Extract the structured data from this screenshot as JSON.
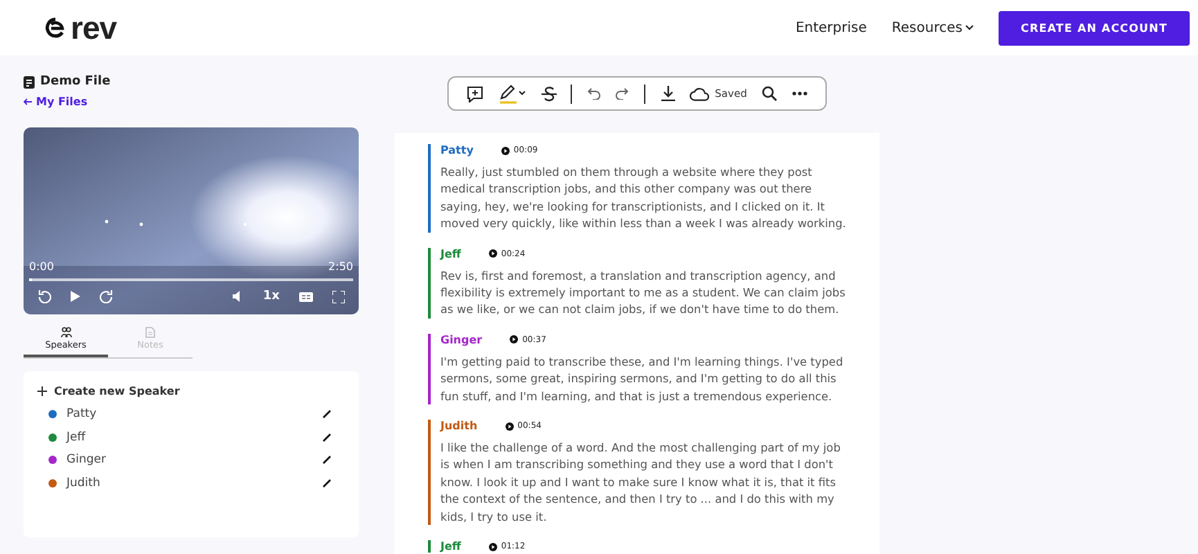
{
  "header": {
    "logo": "rev",
    "nav": [
      {
        "label": "Enterprise",
        "kind": "link"
      },
      {
        "label": "Resources",
        "kind": "dropdown"
      }
    ],
    "cta": "CREATE AN ACCOUNT"
  },
  "file": {
    "title": "Demo File",
    "back": "My Files"
  },
  "player": {
    "current": "0:00",
    "duration": "2:50",
    "level": 0,
    "speed": "1x"
  },
  "side_tabs": [
    {
      "label": "Speakers",
      "selected": true
    },
    {
      "label": "Notes",
      "selected": false
    }
  ],
  "speakers": {
    "create": "Create new Speaker",
    "items": [
      {
        "name": "Patty",
        "color": "#1f6cc1"
      },
      {
        "name": "Jeff",
        "color": "#1e8a3c"
      },
      {
        "name": "Ginger",
        "color": "#a526c9"
      },
      {
        "name": "Judith",
        "color": "#c25b14"
      }
    ]
  },
  "toolbar": {
    "saved": "Saved"
  },
  "transcript": [
    {
      "speaker": "Patty",
      "color": "#1f6cc1",
      "time": "00:09",
      "text": "Really, just stumbled on them through a website where they post medical transcription jobs, and this other company was out there saying, hey, we're looking for transcriptionists, and I clicked on it. It moved very quickly, like within less than a week I was already working."
    },
    {
      "speaker": "Jeff",
      "color": "#1e8a3c",
      "time": "00:24",
      "text": "Rev is, first and foremost, a translation and transcription agency, and flexibility is extremely important to me as a student. We can claim jobs as we like, or we can not claim jobs, if we don't have time to do them."
    },
    {
      "speaker": "Ginger",
      "color": "#a526c9",
      "time": "00:37",
      "text": "I'm getting paid to transcribe these, and I'm learning things. I've typed sermons, some great, inspiring sermons, and I'm getting to do all this fun stuff, and I'm learning, and that is just a tremendous experience."
    },
    {
      "speaker": "Judith",
      "color": "#c25b14",
      "time": "00:54",
      "text": "I like the challenge of a word. And the most challenging part of my job is when I am transcribing something and they use a word that I don't know. I look it up and I want to make sure I know what it is, that it fits the context of the sentence, and then I try to ... and I do this with my kids, I try to use it."
    },
    {
      "speaker": "Jeff",
      "color": "#1e8a3c",
      "time": "01:12"
    }
  ]
}
